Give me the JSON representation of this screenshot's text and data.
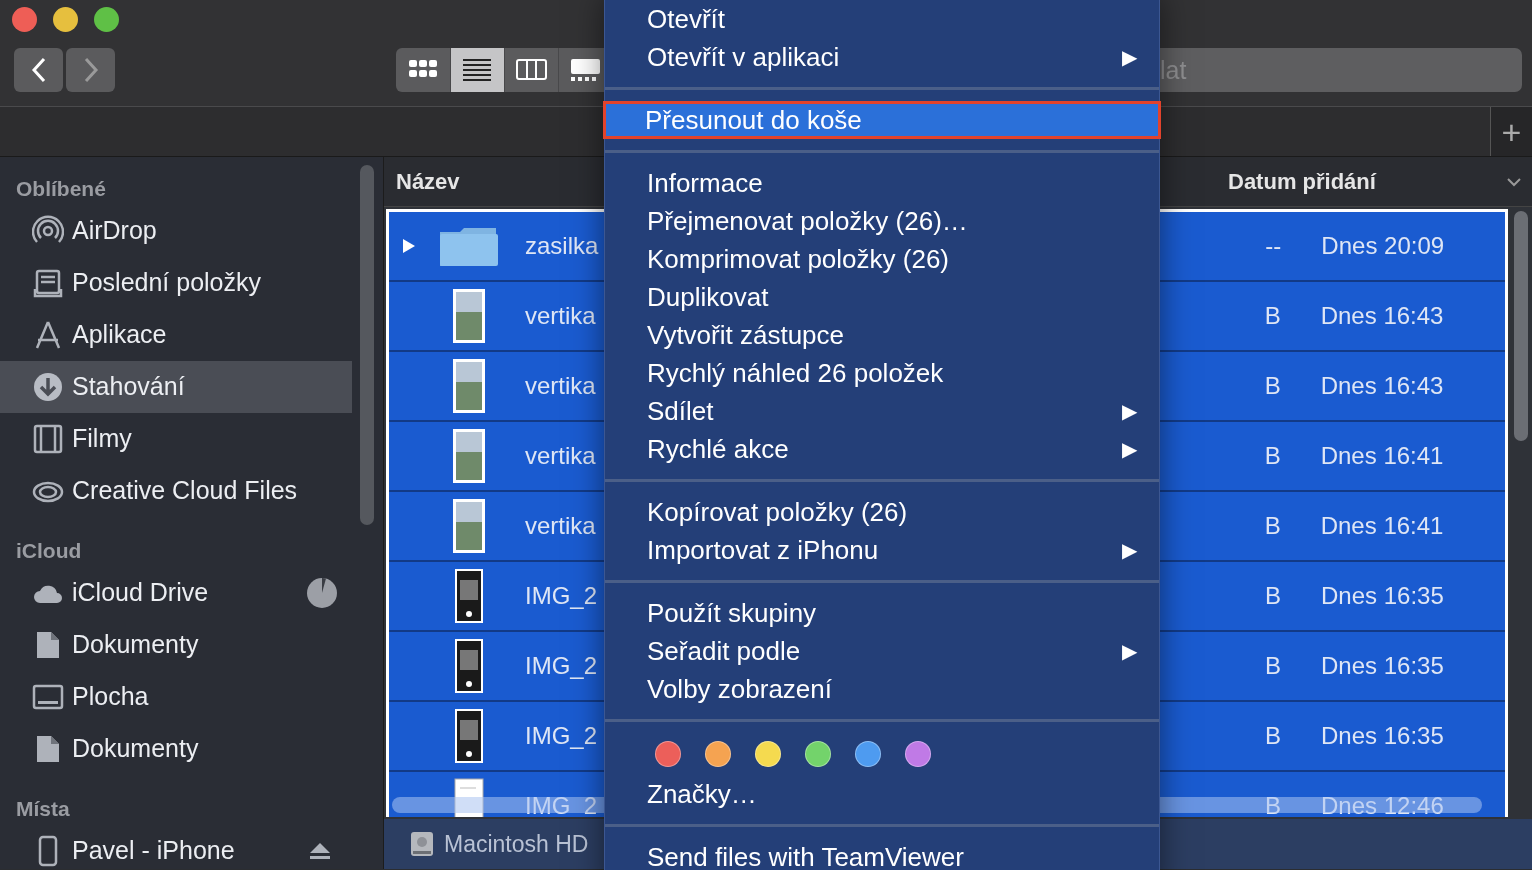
{
  "toolbar": {
    "views": [
      {
        "selected": false
      },
      {
        "selected": true
      },
      {
        "selected": false
      },
      {
        "selected": false
      }
    ],
    "search": {
      "placeholder": "lat"
    }
  },
  "tabbar": {
    "add": "+"
  },
  "sidebar": {
    "sections": [
      {
        "title": "Oblíbené",
        "items": [
          {
            "label": "AirDrop",
            "selected": false
          },
          {
            "label": "Poslední položky",
            "selected": false
          },
          {
            "label": "Aplikace",
            "selected": false
          },
          {
            "label": "Stahování",
            "selected": true
          },
          {
            "label": "Filmy",
            "selected": false
          },
          {
            "label": "Creative Cloud Files",
            "selected": false
          }
        ]
      },
      {
        "title": "iCloud",
        "items": [
          {
            "label": "iCloud Drive",
            "selected": false,
            "syncing": true
          },
          {
            "label": "Dokumenty",
            "selected": false
          },
          {
            "label": "Plocha",
            "selected": false
          },
          {
            "label": "Dokumenty",
            "selected": false
          }
        ]
      },
      {
        "title": "Místa",
        "items": [
          {
            "label": "Pavel - iPhone",
            "selected": false,
            "eject": true
          }
        ]
      }
    ]
  },
  "table": {
    "columns": [
      "Název",
      "Datum přidání"
    ],
    "rows": [
      {
        "kind": "folder",
        "name": "zasilka",
        "size": "--",
        "date": "Dnes 20:09",
        "selected": true
      },
      {
        "kind": "photo",
        "name": "vertika",
        "size": "B",
        "date": "Dnes 16:43",
        "selected": true
      },
      {
        "kind": "photo",
        "name": "vertika",
        "size": "B",
        "date": "Dnes 16:43",
        "selected": true
      },
      {
        "kind": "photo",
        "name": "vertika",
        "size": "B",
        "date": "Dnes 16:41",
        "selected": true
      },
      {
        "kind": "photo",
        "name": "vertika",
        "size": "B",
        "date": "Dnes 16:41",
        "selected": true
      },
      {
        "kind": "screenshot",
        "name": "IMG_2",
        "size": "B",
        "date": "Dnes 16:35",
        "selected": true
      },
      {
        "kind": "screenshot",
        "name": "IMG_2",
        "size": "B",
        "date": "Dnes 16:35",
        "selected": true
      },
      {
        "kind": "screenshot",
        "name": "IMG_2",
        "size": "B",
        "date": "Dnes 16:35",
        "selected": true
      },
      {
        "kind": "document",
        "name": "IMG_2",
        "size": "B",
        "date": "Dnes 12:46",
        "selected": true
      }
    ]
  },
  "status_bar": {
    "path": "Macintosh HD"
  },
  "context_menu": {
    "sections": [
      {
        "items": [
          {
            "label": "Otevřít",
            "submenu": false,
            "selected": false
          },
          {
            "label": "Otevřít v aplikaci",
            "submenu": true,
            "selected": false
          }
        ]
      },
      {
        "items": [
          {
            "label": "Přesunout do koše",
            "submenu": false,
            "selected": true
          }
        ]
      },
      {
        "items": [
          {
            "label": "Informace",
            "submenu": false,
            "selected": false
          },
          {
            "label": "Přejmenovat položky (26)…",
            "submenu": false,
            "selected": false
          },
          {
            "label": "Komprimovat položky (26)",
            "submenu": false,
            "selected": false
          },
          {
            "label": "Duplikovat",
            "submenu": false,
            "selected": false
          },
          {
            "label": "Vytvořit zástupce",
            "submenu": false,
            "selected": false
          },
          {
            "label": "Rychlý náhled 26 položek",
            "submenu": false,
            "selected": false
          },
          {
            "label": "Sdílet",
            "submenu": true,
            "selected": false
          },
          {
            "label": "Rychlé akce",
            "submenu": true,
            "selected": false
          }
        ]
      },
      {
        "items": [
          {
            "label": "Kopírovat položky (26)",
            "submenu": false,
            "selected": false
          },
          {
            "label": "Importovat z iPhonu",
            "submenu": true,
            "selected": false
          }
        ]
      },
      {
        "items": [
          {
            "label": "Použít skupiny",
            "submenu": false,
            "selected": false
          },
          {
            "label": "Seřadit podle",
            "submenu": true,
            "selected": false
          },
          {
            "label": "Volby zobrazení",
            "submenu": false,
            "selected": false
          }
        ]
      },
      {
        "tags": [
          {
            "color": "#ec5f5a"
          },
          {
            "color": "#f5a351"
          },
          {
            "color": "#f5da4f"
          },
          {
            "color": "#73d36b"
          },
          {
            "color": "#4e9bf0"
          },
          {
            "color": "#c07ae6"
          }
        ],
        "items": [
          {
            "label": "Značky…",
            "submenu": false,
            "selected": false
          }
        ]
      },
      {
        "items": [
          {
            "label": "Send files with TeamViewer",
            "submenu": false,
            "selected": false
          }
        ]
      }
    ],
    "submenu_arrow": "▶"
  }
}
